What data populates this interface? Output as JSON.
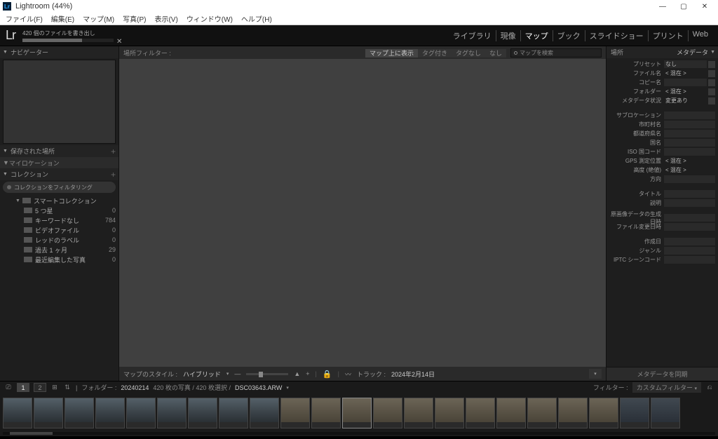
{
  "window": {
    "title": "Lightroom (44%)"
  },
  "menu": [
    "ファイル(F)",
    "編集(E)",
    "マップ(M)",
    "写真(P)",
    "表示(V)",
    "ウィンドウ(W)",
    "ヘルプ(H)"
  ],
  "logo": "Lr",
  "progress": {
    "label": "420 個のファイルを書き出し"
  },
  "modules": {
    "items": [
      "ライブラリ",
      "現像",
      "マップ",
      "ブック",
      "スライドショー",
      "プリント",
      "Web"
    ],
    "active": 2
  },
  "left": {
    "navigator": "ナビゲーター",
    "saved": "保存された場所",
    "myloc": "マイロケーション",
    "collections": "コレクション",
    "filter": "コレクションをフィルタリング",
    "smart": "スマートコレクション",
    "items": [
      {
        "label": "5 つ星",
        "count": "0"
      },
      {
        "label": "キーワードなし",
        "count": "784"
      },
      {
        "label": "ビデオファイル",
        "count": "0"
      },
      {
        "label": "レッドのラベル",
        "count": "0"
      },
      {
        "label": "過去 1 ヶ月",
        "count": "29"
      },
      {
        "label": "最近編集した写真",
        "count": "0"
      }
    ]
  },
  "filterbar": {
    "label": "場所フィルター :",
    "buttons": [
      "マップ上に表示",
      "タグ付き",
      "タグなし",
      "なし"
    ],
    "active": 0,
    "search": "マップを検索"
  },
  "bottombar": {
    "style_label": "マップのスタイル :",
    "style_value": "ハイブリッド",
    "track": "トラック :",
    "date": "2024年2月14日"
  },
  "right": {
    "header_label": "場所",
    "header_meta": "メタデータ",
    "preset_label": "プリセット",
    "preset_value": "なし",
    "rows": [
      {
        "label": "ファイル名",
        "value": "< 混在 >",
        "badge": true
      },
      {
        "label": "コピー名",
        "value": "",
        "boxed": true,
        "badge": true
      },
      {
        "label": "フォルダー",
        "value": "< 混在 >",
        "badge": true
      },
      {
        "label": "メタデータ状況",
        "value": "変更あり",
        "badge": true
      }
    ],
    "rows2": [
      {
        "label": "サブロケーション",
        "value": "",
        "boxed": true
      },
      {
        "label": "市町村名",
        "value": "",
        "boxed": true
      },
      {
        "label": "都道府県名",
        "value": "",
        "boxed": true
      },
      {
        "label": "国名",
        "value": "",
        "boxed": true
      },
      {
        "label": "ISO 国コード",
        "value": "",
        "boxed": true
      },
      {
        "label": "GPS 測定位置",
        "value": "< 混在 >"
      },
      {
        "label": "高度 (絶値)",
        "value": "< 混在 >"
      },
      {
        "label": "方向",
        "value": "",
        "boxed": true
      }
    ],
    "rows3": [
      {
        "label": "タイトル",
        "value": "",
        "boxed": true
      },
      {
        "label": "説明",
        "value": "",
        "boxed": true
      }
    ],
    "rows4": [
      {
        "label": "原画像データの生成日時",
        "value": "",
        "boxed": true
      },
      {
        "label": "ファイル変更日時",
        "value": "",
        "boxed": true
      }
    ],
    "rows5": [
      {
        "label": "作成日",
        "value": "",
        "boxed": true
      },
      {
        "label": "ジャンル",
        "value": "",
        "boxed": true
      },
      {
        "label": "IPTC シーンコード",
        "value": "",
        "boxed": true
      }
    ],
    "sync": "メタデータを同期"
  },
  "toolbar2": {
    "view1": "1",
    "view2": "2",
    "folder_label": "フォルダー :",
    "folder": "20240214",
    "status": "420 枚の写真 / 420 枚選択 /",
    "file": "DSC03643.ARW",
    "filter_label": "フィルター :",
    "filter_value": "カスタムフィルター"
  },
  "thumbs": {
    "count": 22
  }
}
